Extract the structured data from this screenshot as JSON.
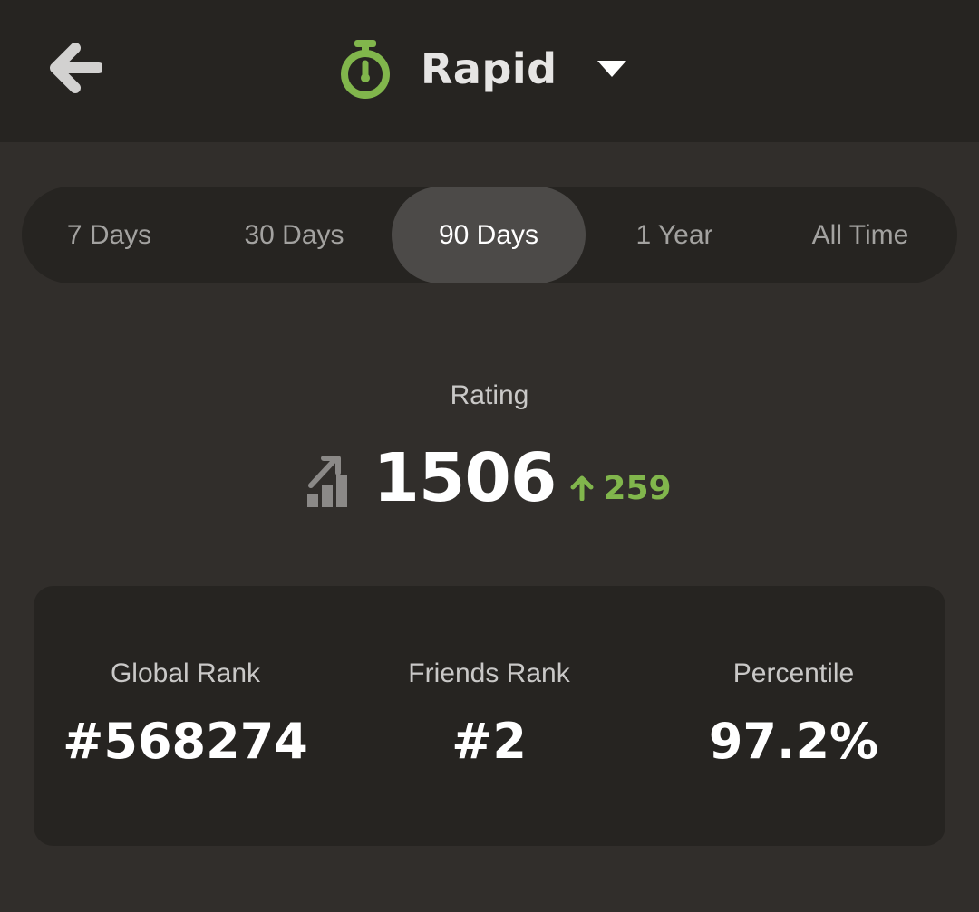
{
  "header": {
    "title": "Rapid",
    "icons": {
      "back": "arrow-left-icon",
      "mode": "stopwatch-icon",
      "dropdown": "caret-down-icon"
    }
  },
  "tabs": [
    {
      "label": "7 Days",
      "active": false
    },
    {
      "label": "30 Days",
      "active": false
    },
    {
      "label": "90 Days",
      "active": true
    },
    {
      "label": "1 Year",
      "active": false
    },
    {
      "label": "All Time",
      "active": false
    }
  ],
  "rating": {
    "label": "Rating",
    "value": "1506",
    "delta": "259",
    "icons": {
      "trend": "rating-trend-icon",
      "delta": "arrow-up-icon"
    }
  },
  "stats": [
    {
      "label": "Global Rank",
      "value": "#568274"
    },
    {
      "label": "Friends Rank",
      "value": "#2"
    },
    {
      "label": "Percentile",
      "value": "97.2%"
    }
  ],
  "colors": {
    "background": "#312e2b",
    "header": "#262421",
    "active_tab": "#4c4a48",
    "accent_green": "#81b64c",
    "muted_text": "#a3a2a0"
  }
}
